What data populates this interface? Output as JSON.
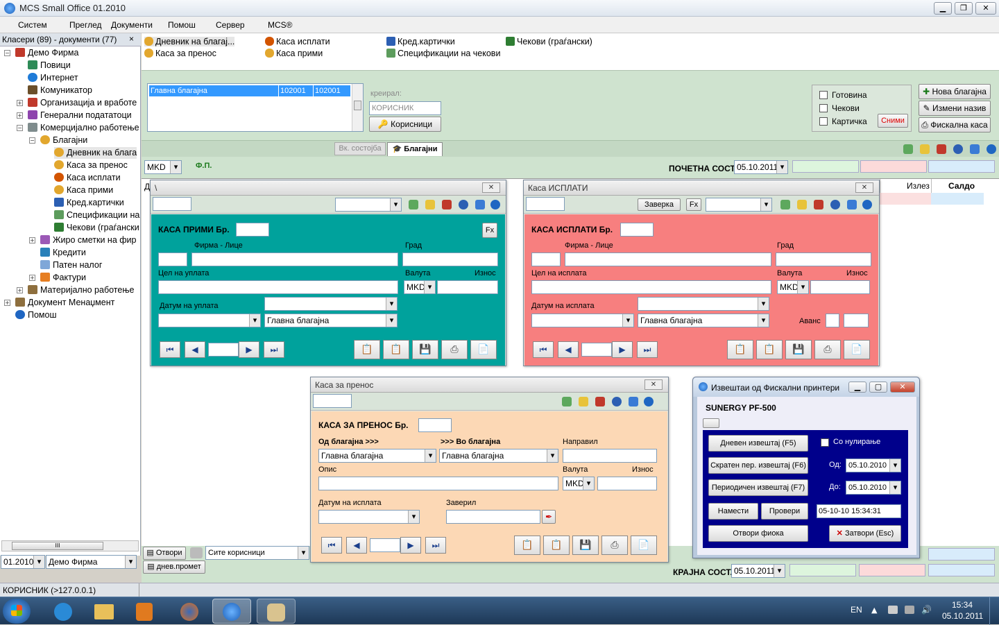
{
  "window": {
    "title": "MCS Small Office 01.2010"
  },
  "menu": [
    "Систем",
    "Преглед",
    "Документи",
    "Помош",
    "Сервер",
    "MCS®"
  ],
  "left_panel": {
    "header": "Класери (89) - документи (77)",
    "close": "×",
    "tree": [
      {
        "label": "Демо Фирма"
      },
      {
        "label": "Повици"
      },
      {
        "label": "Интернет"
      },
      {
        "label": "Комуникатор"
      },
      {
        "label": "Организација и вработе"
      },
      {
        "label": "Генерални подататоци"
      },
      {
        "label": "Комерцијално работење"
      },
      {
        "label": "Благајни"
      },
      {
        "label": "Дневник на блага"
      },
      {
        "label": "Каса за пренос"
      },
      {
        "label": "Каса исплати"
      },
      {
        "label": "Каса прими"
      },
      {
        "label": "Кред.картички"
      },
      {
        "label": "Спецификации на"
      },
      {
        "label": "Чекови (граѓански"
      },
      {
        "label": "Жиро сметки на фир"
      },
      {
        "label": "Кредити"
      },
      {
        "label": "Патен налог"
      },
      {
        "label": "Фактури"
      },
      {
        "label": "Материјално работење"
      },
      {
        "label": "Документ Менаџмент"
      },
      {
        "label": "Помош"
      }
    ],
    "scroll_thumb": "III",
    "period": "01.2010",
    "company": "Демо Фирма",
    "status": "КОРИСНИК (>127.0.0.1)"
  },
  "shortcuts": [
    "Дневник на благај...",
    "Каса исплати",
    "Кред.картички",
    "Чекови (граѓански)",
    "Каса за пренос",
    "Каса прими",
    "Спецификации на чекови"
  ],
  "main": {
    "list_row": {
      "name": "Главна благајна",
      "code1": "102001",
      "code2": "102001"
    },
    "created_label": "креирал:",
    "created_value": "КОРИСНИК",
    "users_btn": "Корисници",
    "checks": [
      "Готовина",
      "Чекови",
      "Картичка"
    ],
    "save_btn": "Сними",
    "new_btn": "Нова благајна",
    "rename_btn": "Измени назив",
    "fiscal_btn": "Фискална каса",
    "tab_inactive": "Вк. состојба",
    "tab_active": "Благајни",
    "currency": "MKD",
    "fp": "Ф.П.",
    "start_label": "ПОЧЕТНА СОСТ.",
    "start_date": "05.10.2011",
    "col_out": "Излез",
    "col_balance": "Салдо",
    "col_d": "Д",
    "open_btn": "Отвори",
    "all_users": "Сите корисници",
    "daily_btn": "днев.промет",
    "end_label": "КРАЈНА СОСТ.",
    "end_date": "05.10.2011"
  },
  "kasa_primi": {
    "title": "\\",
    "heading": "КАСА ПРИМИ Бр.",
    "firm": "Фирма - Лице",
    "city": "Град",
    "purpose": "Цел на уплата",
    "currency_lbl": "Валута",
    "amount_lbl": "Износ",
    "currency": "MKD",
    "date_lbl": "Датум на уплата",
    "cashbox": "Главна благајна",
    "fx": "Fx"
  },
  "kasa_isplati": {
    "title": "Каса ИСПЛАТИ",
    "heading": "КАСА ИСПЛАТИ Бр.",
    "verify_btn": "Заверка",
    "fx": "Fx",
    "firm": "Фирма - Лице",
    "city": "Град",
    "purpose": "Цел на исплата",
    "currency_lbl": "Валута",
    "amount_lbl": "Износ",
    "currency": "MKD",
    "date_lbl": "Датум на исплата",
    "cashbox": "Главна благајна",
    "advance": "Аванс"
  },
  "kasa_prenos": {
    "title": "Каса за пренос",
    "heading": "КАСА ЗА ПРЕНОС Бр.",
    "from_lbl": "Од благајна >>>",
    "to_lbl": ">>> Во благајна",
    "made_lbl": "Направил",
    "from_val": "Главна благајна",
    "to_val": "Главна благајна",
    "desc_lbl": "Опис",
    "currency_lbl": "Валута",
    "amount_lbl": "Износ",
    "currency": "MKD",
    "date_lbl": "Датум на исплата",
    "verified_lbl": "Заверил"
  },
  "fiscal": {
    "title": "Извештаи од Фискални принтери",
    "printer": "SUNERGY PF-500",
    "daily": "Дневен извештај (F5)",
    "zero_lbl": "Со нулирање",
    "short": "Скратен пер. извештај (F6)",
    "from_lbl": "Од:",
    "from_date": "05.10.2010",
    "periodic": "Периодичен извештај (F7)",
    "to_lbl": "До:",
    "to_date": "05.10.2010",
    "set_btn": "Намести",
    "check_btn": "Провери",
    "datetime": "05-10-10 15:34:31",
    "open_drawer": "Отвори фиока",
    "close_btn": "Затвори  (Esc)"
  },
  "taskbar": {
    "lang": "EN",
    "time": "15:34",
    "date": "05.10.2011"
  },
  "colors": {
    "teal": "#00a29c",
    "salmon": "#f77f7f",
    "peach": "#fcd8b5",
    "navy": "#00008b",
    "green_bg": "#cfe3cf"
  }
}
